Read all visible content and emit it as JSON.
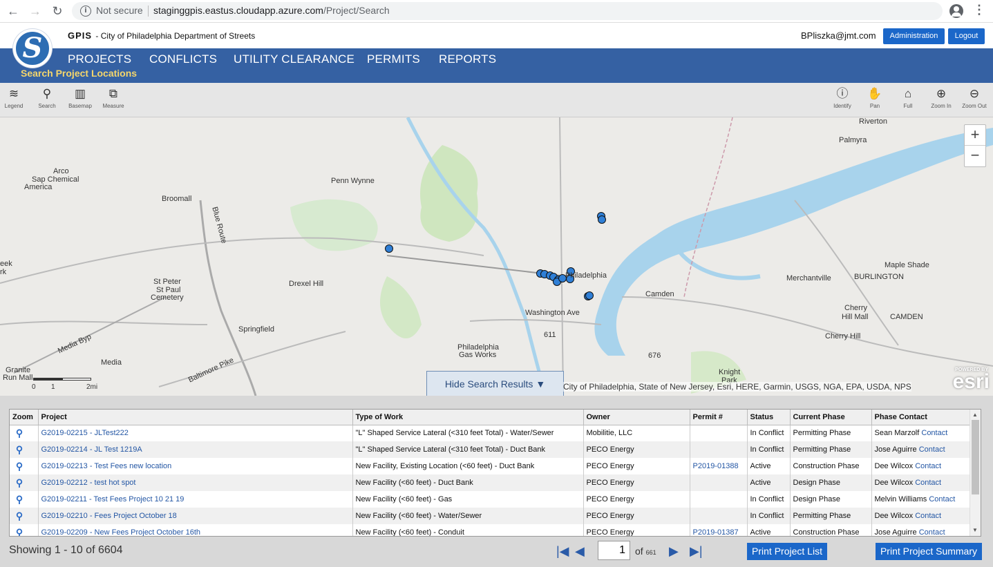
{
  "browser": {
    "not_secure": "Not secure",
    "url_host": "staginggpis.eastus.cloudapp.azure.com",
    "url_path": "/Project/Search"
  },
  "app": {
    "name": "GPIS",
    "org": "- City of Philadelphia Department of Streets",
    "user": "BPliszka@jmt.com",
    "admin_label": "Administration",
    "logout_label": "Logout",
    "nav": [
      "PROJECTS",
      "CONFLICTS",
      "UTILITY CLEARANCE",
      "PERMITS",
      "REPORTS"
    ],
    "subtitle": "Search Project Locations"
  },
  "toolbar": {
    "left": [
      "Legend",
      "Search",
      "Basemap",
      "Measure"
    ],
    "right": [
      "Identify",
      "Pan",
      "Full",
      "Zoom In",
      "Zoom Out"
    ]
  },
  "map": {
    "zoom_in": "+",
    "zoom_out": "−",
    "hide_results": "Hide Search Results",
    "attribution": "City of Philadelphia, State of New Jersey, Esri, HERE, Garmin, USGS, NGA, EPA, USDA, NPS",
    "esri_powered": "POWERED BY",
    "esri": "esri",
    "scale": [
      "0",
      "1",
      "2mi"
    ],
    "labels": [
      "Riverton",
      "Palmyra",
      "Arco",
      "Sap Chemical",
      "America",
      "Broomall",
      "Blue Route",
      "Penn Wynne",
      "St Peter",
      "St Paul",
      "Cemetery",
      "Drexel Hill",
      "Springfield",
      "Media",
      "Media Byp",
      "Baltimore Pike",
      "Granite",
      "Run Mall",
      "Washington Ave",
      "Philadelphia",
      "Gas Works",
      "Philadelphia",
      "Camden",
      "Merchantville",
      "Maple Shade",
      "BURLINGTON",
      "Cherry",
      "Hill Mall",
      "Cherry Hill",
      "CAMDEN",
      "Knight",
      "Park",
      "eek",
      "rk",
      "676",
      "611"
    ],
    "colors": {
      "water": "#a8d3ec",
      "park": "#cde7b8",
      "marker": "#2f7fd6"
    }
  },
  "results": {
    "columns": [
      "Zoom",
      "Project",
      "Type of Work",
      "Owner",
      "Permit #",
      "Status",
      "Current Phase",
      "Phase Contact"
    ],
    "contact_link": "Contact",
    "rows": [
      {
        "project": "G2019-02215 - JLTest222",
        "work": "\"L\" Shaped Service Lateral (<310 feet Total) - Water/Sewer",
        "owner": "Mobilitie, LLC",
        "permit": "",
        "status": "In Conflict",
        "phase": "Permitting Phase",
        "contact": "Sean Marzolf"
      },
      {
        "project": "G2019-02214 - JL Test 1219A",
        "work": "\"L\" Shaped Service Lateral (<310 feet Total) - Duct Bank",
        "owner": "PECO Energy",
        "permit": "",
        "status": "In Conflict",
        "phase": "Permitting Phase",
        "contact": "Jose Aguirre"
      },
      {
        "project": "G2019-02213 - Test Fees new location",
        "work": "New Facility, Existing Location (<60 feet) - Duct Bank",
        "owner": "PECO Energy",
        "permit": "P2019-01388",
        "status": "Active",
        "phase": "Construction Phase",
        "contact": "Dee Wilcox"
      },
      {
        "project": "G2019-02212 - test hot spot",
        "work": "New Facility (<60 feet) - Duct Bank",
        "owner": "PECO Energy",
        "permit": "",
        "status": "Active",
        "phase": "Design Phase",
        "contact": "Dee Wilcox"
      },
      {
        "project": "G2019-02211 - Test Fees Project 10 21 19",
        "work": "New Facility (<60 feet) - Gas",
        "owner": "PECO Energy",
        "permit": "",
        "status": "In Conflict",
        "phase": "Design Phase",
        "contact": "Melvin Williams"
      },
      {
        "project": "G2019-02210 - Fees Project October 18",
        "work": "New Facility (<60 feet) - Water/Sewer",
        "owner": "PECO Energy",
        "permit": "",
        "status": "In Conflict",
        "phase": "Permitting Phase",
        "contact": "Dee Wilcox"
      },
      {
        "project": "G2019-02209 - New Fees Project October 16th",
        "work": "New Facility (<60 feet) - Conduit",
        "owner": "PECO Energy",
        "permit": "P2019-01387",
        "status": "Active",
        "phase": "Construction Phase",
        "contact": "Jose Aguirre"
      }
    ],
    "showing": "Showing 1 - 10 of 6604",
    "page": "1",
    "of_label": "of",
    "total_pages": "661",
    "print_list": "Print Project List",
    "print_summary": "Print Project Summary"
  }
}
